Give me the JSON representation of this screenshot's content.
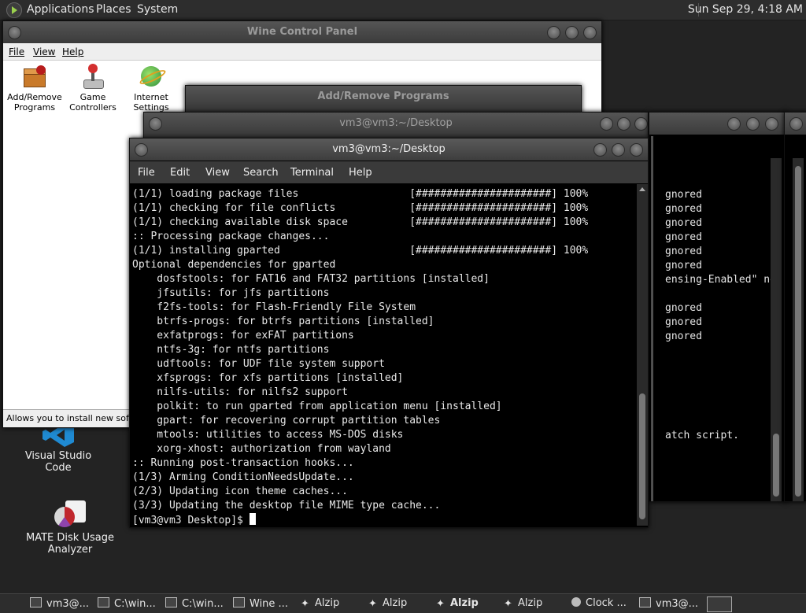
{
  "top_panel": {
    "menus": [
      "Applications",
      "Places",
      "System"
    ],
    "clock": "Sun Sep 29,  4:18 AM"
  },
  "desktop": {
    "icons": [
      {
        "label": "Visual Studio Code",
        "icon": "vscode-icon"
      },
      {
        "label_line1": "MATE Disk Usage",
        "label_line2": "Analyzer",
        "icon": "disk-usage-icon"
      }
    ]
  },
  "wine": {
    "title": "Wine Control Panel",
    "menu": [
      "File",
      "View",
      "Help"
    ],
    "items": [
      {
        "line1": "Add/Remove",
        "line2": "Programs"
      },
      {
        "line1": "Game",
        "line2": "Controllers"
      },
      {
        "line1": "Internet",
        "line2": "Settings"
      }
    ],
    "status": "Allows you to install new software"
  },
  "addremove": {
    "title": "Add/Remove Programs"
  },
  "term_back": {
    "title": "vm3@vm3:~/Desktop",
    "right_lines": [
      "gnored",
      "gnored",
      "gnored",
      "gnored",
      "gnored",
      "gnored",
      "ensing-Enabled\" no",
      "",
      "gnored",
      "gnored",
      "gnored",
      "",
      "",
      "",
      "",
      "",
      "",
      "atch script."
    ]
  },
  "terminal": {
    "title": "vm3@vm3:~/Desktop",
    "menu": [
      "File",
      "Edit",
      "View",
      "Search",
      "Terminal",
      "Help"
    ],
    "lines": [
      "(1/1) loading package files                  [######################] 100%",
      "(1/1) checking for file conflicts            [######################] 100%",
      "(1/1) checking available disk space          [######################] 100%",
      ":: Processing package changes...",
      "(1/1) installing gparted                     [######################] 100%",
      "Optional dependencies for gparted",
      "    dosfstools: for FAT16 and FAT32 partitions [installed]",
      "    jfsutils: for jfs partitions",
      "    f2fs-tools: for Flash-Friendly File System",
      "    btrfs-progs: for btrfs partitions [installed]",
      "    exfatprogs: for exFAT partitions",
      "    ntfs-3g: for ntfs partitions",
      "    udftools: for UDF file system support",
      "    xfsprogs: for xfs partitions [installed]",
      "    nilfs-utils: for nilfs2 support",
      "    polkit: to run gparted from application menu [installed]",
      "    gpart: for recovering corrupt partition tables",
      "    mtools: utilities to access MS-DOS disks",
      "    xorg-xhost: authorization from wayland",
      ":: Running post-transaction hooks...",
      "(1/3) Arming ConditionNeedsUpdate...",
      "(2/3) Updating icon theme caches...",
      "(3/3) Updating the desktop file MIME type cache..."
    ],
    "prompt": "[vm3@vm3 Desktop]$ "
  },
  "taskbar": {
    "tasks": [
      {
        "label": "vm3@...",
        "bold": false
      },
      {
        "label": "C:\\win...",
        "bold": false
      },
      {
        "label": "C:\\win...",
        "bold": false
      },
      {
        "label": "Wine ...",
        "bold": false
      },
      {
        "label": "Alzip",
        "bold": false
      },
      {
        "label": "Alzip",
        "bold": false
      },
      {
        "label": "Alzip",
        "bold": true
      },
      {
        "label": "Alzip",
        "bold": false
      },
      {
        "label": "Clock ...",
        "bold": false
      },
      {
        "label": "vm3@...",
        "bold": false
      }
    ]
  }
}
